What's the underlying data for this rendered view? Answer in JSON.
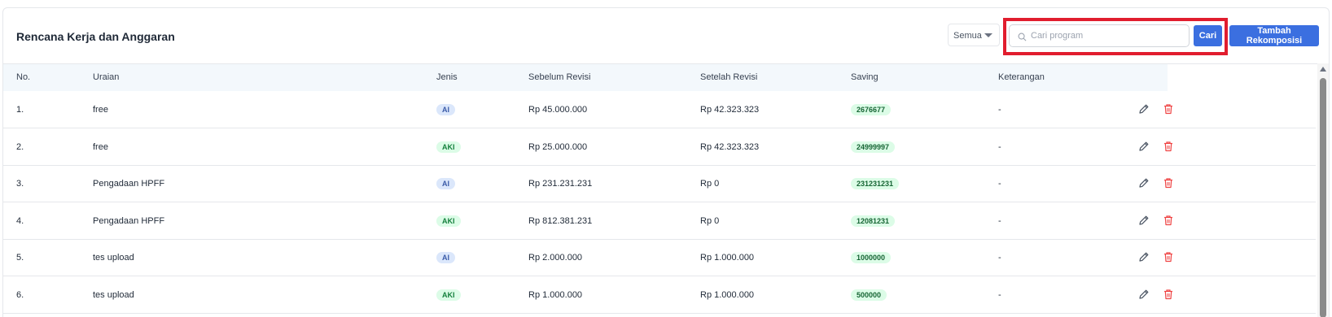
{
  "header": {
    "title": "Rencana Kerja dan Anggaran",
    "filter_value": "Semua",
    "search_placeholder": "Cari program",
    "search_button": "Cari",
    "add_button": "Tambah Rekomposisi"
  },
  "table": {
    "columns": [
      "No.",
      "Uraian",
      "Jenis",
      "Sebelum Revisi",
      "Setelah Revisi",
      "Saving",
      "Keterangan"
    ],
    "rows": [
      {
        "no": "1.",
        "uraian": "free",
        "jenis": "AI",
        "sebelum": "Rp 45.000.000",
        "setelah": "Rp 42.323.323",
        "saving": "2676677",
        "keterangan": "-"
      },
      {
        "no": "2.",
        "uraian": "free",
        "jenis": "AKI",
        "sebelum": "Rp 25.000.000",
        "setelah": "Rp 42.323.323",
        "saving": "24999997",
        "keterangan": "-"
      },
      {
        "no": "3.",
        "uraian": "Pengadaan HPFF",
        "jenis": "AI",
        "sebelum": "Rp 231.231.231",
        "setelah": "Rp 0",
        "saving": "231231231",
        "keterangan": "-"
      },
      {
        "no": "4.",
        "uraian": "Pengadaan HPFF",
        "jenis": "AKI",
        "sebelum": "Rp 812.381.231",
        "setelah": "Rp 0",
        "saving": "12081231",
        "keterangan": "-"
      },
      {
        "no": "5.",
        "uraian": "tes upload",
        "jenis": "AI",
        "sebelum": "Rp 2.000.000",
        "setelah": "Rp 1.000.000",
        "saving": "1000000",
        "keterangan": "-"
      },
      {
        "no": "6.",
        "uraian": "tes upload",
        "jenis": "AKI",
        "sebelum": "Rp 1.000.000",
        "setelah": "Rp 1.000.000",
        "saving": "500000",
        "keterangan": "-"
      }
    ]
  },
  "icons": {
    "search": "search-icon",
    "edit": "pencil-icon",
    "delete": "trash-icon"
  },
  "colors": {
    "primary": "#3b6fe0",
    "danger": "#e11d2e",
    "delete_icon": "#ef4444"
  }
}
